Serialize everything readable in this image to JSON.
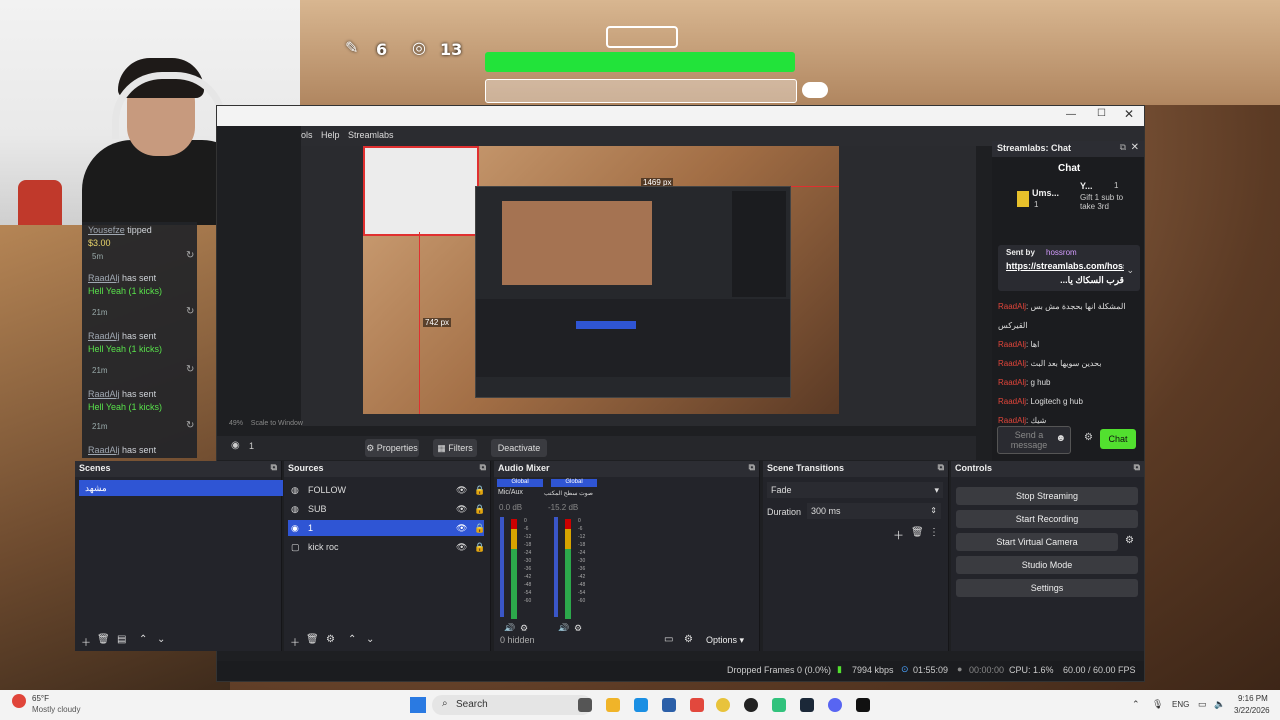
{
  "hud": {
    "pencil_count": "6",
    "target_count": "13"
  },
  "alerts": {
    "items": [
      {
        "user": "Yousefze",
        "action": "tipped",
        "detail": "$3.00",
        "time": "5m"
      },
      {
        "user": "RaadAlj",
        "action": "has sent",
        "detail": "Hell Yeah (1 kicks)",
        "time": "21m"
      },
      {
        "user": "RaadAlj",
        "action": "has sent",
        "detail": "Hell Yeah (1 kicks)",
        "time": "21m"
      },
      {
        "user": "RaadAlj",
        "action": "has sent",
        "detail": "Hell Yeah (1 kicks)",
        "time": "21m"
      },
      {
        "user": "RaadAlj",
        "action": "has sent",
        "detail": ""
      }
    ]
  },
  "obs": {
    "menu": [
      "ols",
      "Help",
      "Streamlabs"
    ],
    "preview": {
      "width_label": "1469 px",
      "height_label": "742 px",
      "zoom": "49%",
      "scale_label": "Scale to Window"
    },
    "toolbar": {
      "scene_count": "1",
      "properties": "Properties",
      "filters": "Filters",
      "deactivate": "Deactivate"
    },
    "chat": {
      "title": "Streamlabs: Chat",
      "header": "Chat",
      "top_user": "Ums...",
      "top_user_count": "1",
      "sub_user": "Y...",
      "sub_user_count": "1",
      "gift_text": "Gift 1 sub to take 3rd",
      "sent_by": "Sent by",
      "sent_by_user": "hossrom",
      "pinned_link": "https://streamlabs.com/hossrom/tip",
      "pinned_arabic": "قرب السكاك يا...",
      "messages": [
        {
          "user": "RaadAlj",
          "text": "المشكلة انها بحجدة مش بس القيركس"
        },
        {
          "user": "RaadAlj",
          "text": "اها"
        },
        {
          "user": "RaadAlj",
          "text": "بحدين سويها بعد البث"
        },
        {
          "user": "RaadAlj",
          "text": "g hub"
        },
        {
          "user": "RaadAlj",
          "text": "Logitech g hub"
        },
        {
          "user": "RaadAlj",
          "text": "شيك"
        }
      ],
      "placeholder": "Send a message",
      "send": "Chat"
    },
    "docks": {
      "scenes": {
        "title": "Scenes",
        "items": [
          "مشهد"
        ]
      },
      "sources": {
        "title": "Sources",
        "items": [
          "FOLLOW",
          "SUB",
          "1",
          "kick roc"
        ]
      },
      "mixer": {
        "title": "Audio Mixer",
        "channels": [
          {
            "scope": "Global",
            "name": "Mic/Aux",
            "level": "0.0 dB"
          },
          {
            "scope": "Global",
            "name": "صوت سطح المكتب",
            "level": "-15.2 dB"
          }
        ],
        "ticks": [
          "0",
          "-6",
          "-12",
          "-18",
          "-24",
          "-30",
          "-36",
          "-42",
          "-48",
          "-54",
          "-60"
        ],
        "hidden": "0 hidden",
        "options": "Options"
      },
      "transitions": {
        "title": "Scene Transitions",
        "type": "Fade",
        "duration_label": "Duration",
        "duration": "300 ms"
      },
      "controls": {
        "title": "Controls",
        "buttons": [
          "Stop Streaming",
          "Start Recording",
          "Start Virtual Camera",
          "Studio Mode",
          "Settings"
        ]
      }
    },
    "status": {
      "dropped": "Dropped Frames 0 (0.0%)",
      "kbps": "7994 kbps",
      "stream_time": "01:55:09",
      "rec_time": "00:00:00",
      "cpu": "CPU: 1.6%",
      "fps": "60.00 / 60.00 FPS"
    }
  },
  "taskbar": {
    "weather_temp": "65°F",
    "weather_desc": "Mostly cloudy",
    "search": "Search",
    "lang": "ENG",
    "time": "9:16 PM",
    "date": "3/22/2026"
  },
  "colors": {
    "accent": "#2f55d4",
    "hp_green": "#22e33a",
    "chat_send": "#52e02f",
    "chat_user": "#e0453a"
  }
}
